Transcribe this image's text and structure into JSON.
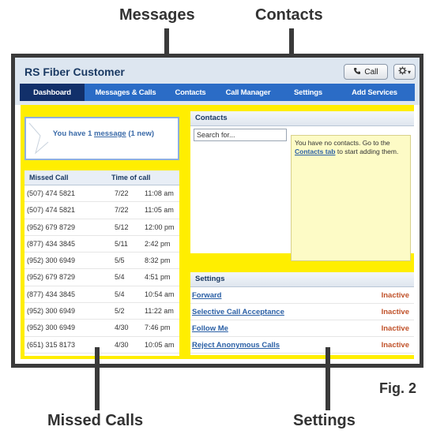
{
  "callouts": {
    "messages": "Messages",
    "contacts": "Contacts",
    "missed_calls": "Missed Calls",
    "settings": "Settings",
    "fig": "Fig. 2"
  },
  "header": {
    "title": "RS Fiber Customer",
    "call_label": "Call",
    "gear_caret": "▾"
  },
  "nav": {
    "items": [
      "Dashboard",
      "Messages & Calls",
      "Contacts",
      "Call Manager",
      "Settings",
      "Add Services"
    ],
    "active": "Dashboard"
  },
  "messages": {
    "prefix": "You have 1 ",
    "link": "message",
    "suffix": " (1 new)"
  },
  "missed_calls": {
    "col_number": "Missed Call",
    "col_time": "Time of call",
    "rows": [
      {
        "number": "(507) 474 5821",
        "date": "7/22",
        "time": "11:08 am"
      },
      {
        "number": "(507) 474 5821",
        "date": "7/22",
        "time": "11:05 am"
      },
      {
        "number": "(952) 679 8729",
        "date": "5/12",
        "time": "12:00 pm"
      },
      {
        "number": "(877) 434 3845",
        "date": "5/11",
        "time": "2:42 pm"
      },
      {
        "number": "(952) 300 6949",
        "date": "5/5",
        "time": "8:32 pm"
      },
      {
        "number": "(952) 679 8729",
        "date": "5/4",
        "time": "4:51 pm"
      },
      {
        "number": "(877) 434 3845",
        "date": "5/4",
        "time": "10:54 am"
      },
      {
        "number": "(952) 300 6949",
        "date": "5/2",
        "time": "11:22 am"
      },
      {
        "number": "(952) 300 6949",
        "date": "4/30",
        "time": "7:46 pm"
      },
      {
        "number": "(651) 315 8173",
        "date": "4/30",
        "time": "10:05 am"
      }
    ]
  },
  "contacts": {
    "title": "Contacts",
    "search_placeholder": "Search for...",
    "note_before": "You have no contacts. Go to the ",
    "note_link": "Contacts tab",
    "note_after": " to start adding them."
  },
  "settings": {
    "title": "Settings",
    "rows": [
      {
        "name": "Forward",
        "status": "Inactive"
      },
      {
        "name": "Selective Call Acceptance",
        "status": "Inactive"
      },
      {
        "name": "Follow Me",
        "status": "Inactive"
      },
      {
        "name": "Reject Anonymous Calls",
        "status": "Inactive"
      }
    ]
  },
  "colors": {
    "highlight": "#ffee00",
    "nav_bg": "#2b6cc6",
    "nav_active": "#12306a",
    "inactive": "#c0522a"
  }
}
